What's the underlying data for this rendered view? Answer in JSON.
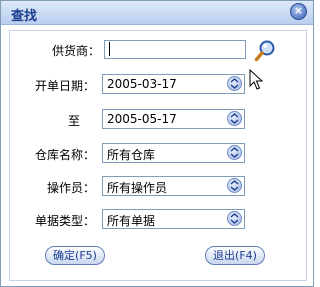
{
  "dialog": {
    "title": "查找",
    "close_symbol": "×"
  },
  "form": {
    "supplier": {
      "label": "供货商：",
      "value": ""
    },
    "start_date": {
      "label": "开单日期：",
      "value": "2005-03-17"
    },
    "end_date": {
      "label": "至",
      "value": "2005-05-17"
    },
    "warehouse": {
      "label": "仓库名称：",
      "value": "所有仓库"
    },
    "operator": {
      "label": "操作员：",
      "value": "所有操作员"
    },
    "doc_type": {
      "label": "单据类型：",
      "value": "所有单据"
    }
  },
  "buttons": {
    "confirm_label": "确定(F5)",
    "exit_label": "退出(F4)"
  },
  "icons": {
    "close": "close-icon",
    "search": "magnifier-icon",
    "dropdown": "chevron-down-icon",
    "cursor": "mouse-pointer-icon"
  },
  "colors": {
    "title": "#1b3d8f",
    "border": "#7f9db9",
    "titlebar": "#b9ceee"
  }
}
